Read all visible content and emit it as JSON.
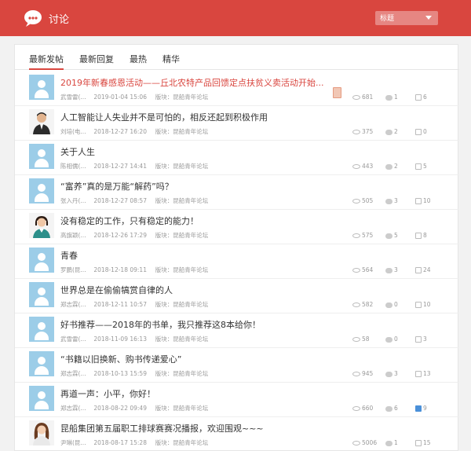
{
  "header": {
    "title": "讨论",
    "search_select": "标题"
  },
  "tabs": [
    "最新发帖",
    "最新回复",
    "最热",
    "精华"
  ],
  "meta_labels": {
    "board_prefix": "版块："
  },
  "posts": [
    {
      "title": "2019年新春感恩活动——丘北农特产品回馈定点扶贫义卖活动开始...",
      "author": "武雪雷(...",
      "date": "2019-01-04 15:06",
      "board": "昆船青年论坛",
      "views": "681",
      "replies": "1",
      "likes": "6"
    },
    {
      "title": "人工智能让人失业并不是可怕的，相反还起到积极作用",
      "author": "刘培(电...",
      "date": "2018-12-27 16:20",
      "board": "昆船青年论坛",
      "views": "375",
      "replies": "2",
      "likes": "0"
    },
    {
      "title": "关于人生",
      "author": "陈相儒(...",
      "date": "2018-12-27 14:41",
      "board": "昆船青年论坛",
      "views": "443",
      "replies": "2",
      "likes": "5"
    },
    {
      "title": "“富养”真的是万能“解药”吗？",
      "author": "张入丹(...",
      "date": "2018-12-27 08:57",
      "board": "昆船青年论坛",
      "views": "505",
      "replies": "3",
      "likes": "10"
    },
    {
      "title": "没有稳定的工作，只有稳定的能力！",
      "author": "高旗颖(...",
      "date": "2018-12-26 17:29",
      "board": "昆船青年论坛",
      "views": "575",
      "replies": "5",
      "likes": "8"
    },
    {
      "title": "青春",
      "author": "罗鹏(昆...",
      "date": "2018-12-18 09:11",
      "board": "昆船青年论坛",
      "views": "564",
      "replies": "3",
      "likes": "24"
    },
    {
      "title": "世界总是在偷偷犒赏自律的人",
      "author": "郑志霖(...",
      "date": "2018-12-11 10:57",
      "board": "昆船青年论坛",
      "views": "582",
      "replies": "0",
      "likes": "10"
    },
    {
      "title": "好书推荐——2018年的书单，我只推荐这8本给你！",
      "author": "武雪雷(...",
      "date": "2018-11-09 16:13",
      "board": "昆船青年论坛",
      "views": "58",
      "replies": "0",
      "likes": "3"
    },
    {
      "title": "“书籍以旧换新、购书传递爱心”",
      "author": "郑志霖(...",
      "date": "2018-10-13 15:59",
      "board": "昆船青年论坛",
      "views": "945",
      "replies": "3",
      "likes": "13"
    },
    {
      "title": "再道一声：小平，你好！",
      "author": "郑志霖(...",
      "date": "2018-08-22 09:49",
      "board": "昆船青年论坛",
      "views": "660",
      "replies": "6",
      "likes": "9"
    },
    {
      "title": "昆船集团第五届职工排球赛赛况播报，欢迎围观~~~",
      "author": "尹琳(昆...",
      "date": "2018-08-17 15:28",
      "board": "昆船青年论坛",
      "views": "5006",
      "replies": "1",
      "likes": "15"
    }
  ]
}
